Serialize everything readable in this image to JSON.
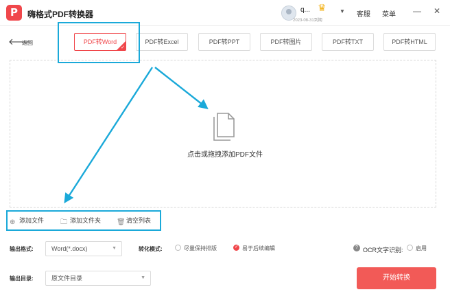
{
  "app": {
    "title": "嗨格式PDF转换器",
    "logo": "P"
  },
  "user": {
    "name": "q...",
    "expire": "2023-08-31到期",
    "menu_arrow": "▼"
  },
  "header_links": {
    "service": "客服",
    "menu": "菜单"
  },
  "window_buttons": {
    "minimize": "—",
    "close": "✕"
  },
  "nav": {
    "back_label": "返回",
    "back_arrow": "🡐"
  },
  "tabs": [
    {
      "label": "PDF转Word",
      "active": true
    },
    {
      "label": "PDF转Excel"
    },
    {
      "label": "PDF转PPT"
    },
    {
      "label": "PDF转图片"
    },
    {
      "label": "PDF转TXT"
    },
    {
      "label": "PDF转HTML"
    }
  ],
  "dropzone": {
    "hint": "点击或拖拽添加PDF文件",
    "icon": "document-icon"
  },
  "actions": [
    {
      "label": "添加文件",
      "icon": "add-circle-icon"
    },
    {
      "label": "添加文件夹",
      "icon": "folder-icon"
    },
    {
      "label": "清空列表",
      "icon": "trash-icon"
    }
  ],
  "options": {
    "format_label": "输出格式:",
    "format_value": "Word(*.docx)",
    "mode_label": "转化模式:",
    "mode_options": [
      {
        "label": "尽量保持排版",
        "checked": false
      },
      {
        "label": "易于后续编辑",
        "checked": true
      }
    ],
    "ocr_label": "OCR文字识别:",
    "ocr_option": "启用",
    "output_dir_label": "输出目录:",
    "output_dir_value": "原文件目录"
  },
  "start_button": "开始转换",
  "colors": {
    "accent": "#f0474b",
    "annotation": "#1aa9d9",
    "start_button": "#f25a57"
  }
}
